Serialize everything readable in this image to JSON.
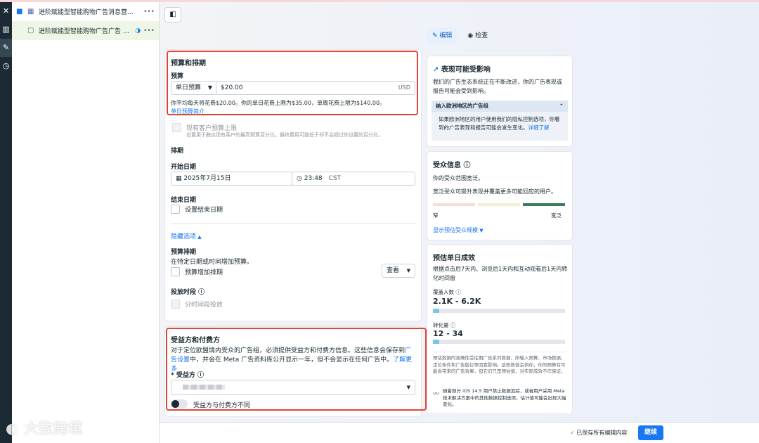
{
  "rail": {
    "icons": [
      "close-icon",
      "chart-icon",
      "edit-icon",
      "history-icon"
    ]
  },
  "tree": {
    "campaign_label": "进阶赋能型智能购物广告消息营...",
    "ad_label": "进阶赋能型智能购物广告广告 2...",
    "more": "•••"
  },
  "modes": {
    "edit": "编辑",
    "review": "检查"
  },
  "budget": {
    "section_title": "预算和排期",
    "budget_label": "预算",
    "budget_type": "单日预算",
    "amount": "$20.00",
    "currency": "USD",
    "avg_note": "你平均每天将花费$20.00。你的单日花费上限为$35.00，单周花费上限为$140.00。",
    "intro_link": "单日预算简介",
    "existing_cap_label": "现有客户预算上限",
    "existing_cap_desc": "设置用于触达现有客户的最高预算百分比。最终费用可能低于却不会超过你设置的百分比。",
    "schedule_label": "排期",
    "start_date_label": "开始日期",
    "start_date": "2025年7月15日",
    "start_time": "23:48",
    "timezone": "CST",
    "end_date_label": "结束日期",
    "set_end_label": "设置结束日期",
    "hide_options": "隐藏选项",
    "budget_schedule_label": "预算排期",
    "budget_schedule_desc": "在特定日期或时间增加预算。",
    "increase_label": "预算增加排期",
    "view_label": "查看",
    "delivery_label": "投放时段",
    "dayparting_label": "分时间段投放"
  },
  "beneficiary": {
    "section_title": "受益方和付费方",
    "desc_part1": "对于定位欧盟境内受众的广告组，必须提供受益方和付费方信息。这些信息会保存到",
    "ad_settings_link": "广告设置",
    "desc_part2": "中，并会在 Meta 广告资料库公开显示一年，但不会显示在任何广告中。",
    "learn_more": "了解更多",
    "beneficiary_label": "* 受益方",
    "different_payer": "受益方与付费方不同"
  },
  "perf": {
    "title": "表现可能受影响",
    "desc": "我们的广告生态系统正在不断改进，你的广告表现或报告可能会受到影响。",
    "eu_title": "纳入欧洲地区的广告组",
    "eu_desc": "如果欧洲地区的用户使用我们的隐私控制选项，你看到的广告表现和报告可能会发生变化。",
    "eu_link": "详细了解"
  },
  "audience": {
    "title": "受众信息",
    "line1": "你的受众范围宽泛。",
    "line2": "宽泛受众可提升表现并覆盖更多可能回应的用户。",
    "narrow": "窄",
    "broad": "宽泛",
    "show_estimate": "显示预估受众规模"
  },
  "estimate": {
    "title": "预估单日成效",
    "desc": "根据点击后7天内、浏览后1天内和互动观看后1天内转化时间窗",
    "reach_label": "覆盖人数",
    "reach_value": "2.1K - 6.2K",
    "reach_fill": 0.05,
    "conv_label": "转化量",
    "conv_value": "12 - 34",
    "conv_fill": 0.05,
    "note": "预估数据的准确性受往期广告系列数据、所输入预算、市场数据、定位条件和广告版位等因素影响。这些数值会供你，你的预算有可能会带来的广告效果，但它们只是预估值，对实际成效不作保证。",
    "ios_note": "随着部分 iOS 14.5 用户禁止数据追踪，或者用户采用 Meta 技术解决方案中的其他数据控制选项，估计值可能会出现大幅变化。"
  },
  "footer": {
    "saved": "已保存所有编辑内容",
    "continue": "继续"
  },
  "watermark": "大数跨境",
  "colors": {
    "accent": "#1877f2",
    "highlight": "#e0463a",
    "bar_fill": "#7ec4e6"
  }
}
